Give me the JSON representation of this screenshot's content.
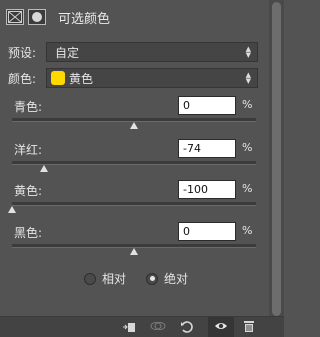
{
  "header": {
    "title": "可选颜色",
    "layer_icon": "adjustment-layer-icon",
    "mask_icon": "layer-mask-icon"
  },
  "preset": {
    "label": "预设:",
    "value": "自定"
  },
  "colors": {
    "label": "颜色:",
    "value": "黄色",
    "swatch_color": "#ffd800"
  },
  "sliders": [
    {
      "label": "青色:",
      "value": "0",
      "unit": "%",
      "level": 0
    },
    {
      "label": "洋红:",
      "value": "-74",
      "unit": "%",
      "level": -74
    },
    {
      "label": "黄色:",
      "value": "-100",
      "unit": "%",
      "level": -100
    },
    {
      "label": "黑色:",
      "value": "0",
      "unit": "%",
      "level": 0
    }
  ],
  "method": {
    "relative_label": "相对",
    "absolute_label": "绝对",
    "selected": "absolute"
  },
  "footer": {
    "icons": [
      "clip-to-layer-icon",
      "view-previous-icon",
      "reset-icon",
      "visibility-eye-icon",
      "delete-icon"
    ]
  }
}
